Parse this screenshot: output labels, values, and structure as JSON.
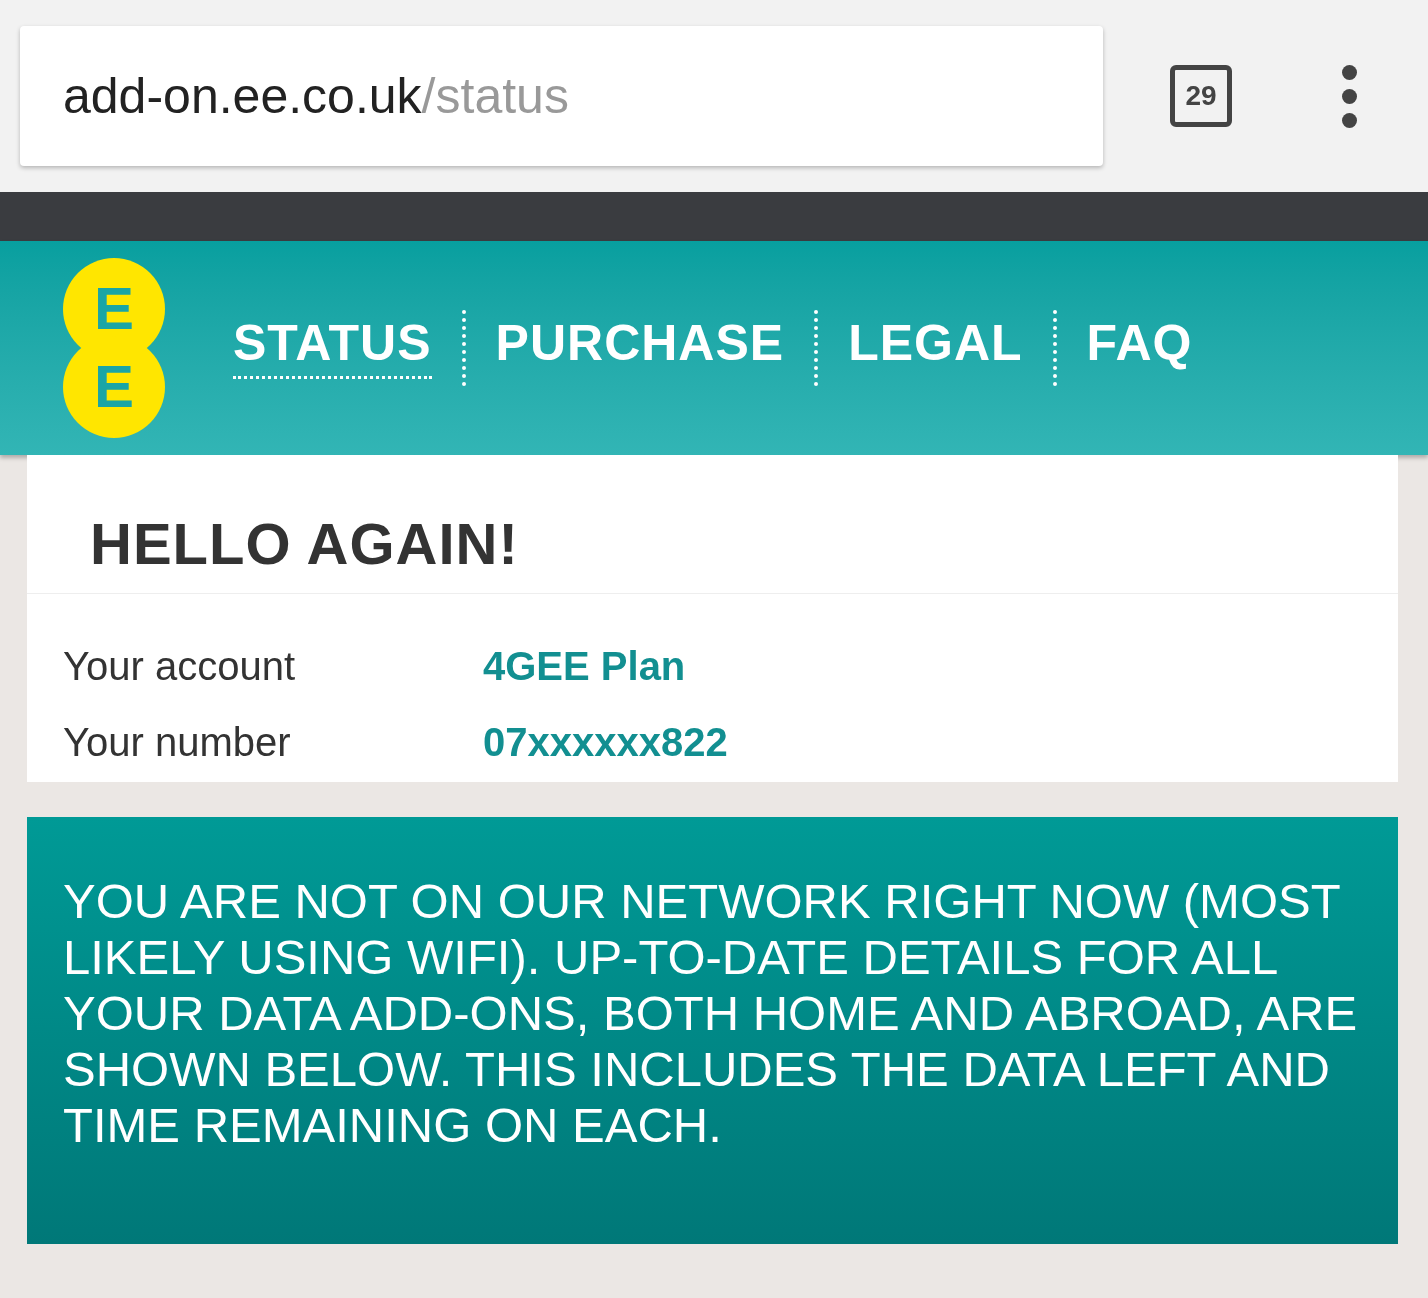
{
  "browser": {
    "url_host": "add-on.ee.co.uk",
    "url_path": "/status",
    "tab_count": "29"
  },
  "logo": {
    "letters": [
      "E",
      "E"
    ]
  },
  "nav": [
    {
      "label": "STATUS",
      "selected": true
    },
    {
      "label": "PURCHASE",
      "selected": false
    },
    {
      "label": "LEGAL",
      "selected": false
    },
    {
      "label": "FAQ",
      "selected": false
    }
  ],
  "greeting": "HELLO AGAIN!",
  "account": [
    {
      "label": "Your account",
      "value": "4GEE Plan"
    },
    {
      "label": "Your number",
      "value": "07xxxxxx822"
    }
  ],
  "notice": "YOU ARE NOT ON OUR NETWORK RIGHT NOW (MOST LIKELY USING WIFI). UP-TO-DATE DETAILS FOR ALL YOUR DATA ADD-ONS, BOTH HOME AND ABROAD, ARE SHOWN BELOW. THIS INCLUDES THE DATA LEFT AND TIME REMAINING ON EACH."
}
